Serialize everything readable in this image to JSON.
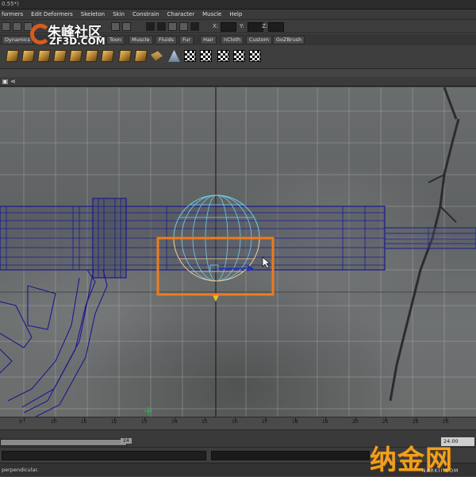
{
  "window": {
    "title_fragment": "0.55*)"
  },
  "menubar": {
    "items": [
      "formers",
      "Edit Deformers",
      "Skeleton",
      "Skin",
      "Constrain",
      "Character",
      "Muscle",
      "Help"
    ]
  },
  "statusline": {
    "x_label": "X:",
    "y_label": "Y:",
    "z_label": "Z:"
  },
  "shelf_tabs": [
    "Dynamics",
    "Toon",
    "Muscle",
    "Fluids",
    "Fur",
    "Hair",
    "nCloth",
    "Custom",
    "GoZBrush"
  ],
  "shelf_icons": [
    "cube-icon",
    "cube-icon",
    "cube-icon",
    "cube-icon",
    "cube-icon",
    "cube-icon",
    "cube-icon",
    "cube-icon",
    "cube-icon",
    "cube-icon",
    "cube-icon",
    "plane-icon",
    "cone-icon",
    "plane-icon",
    "checker-icon",
    "checker-icon",
    "checker-icon",
    "checker-icon",
    "checker-icon"
  ],
  "timeline": {
    "ticks": [
      "9",
      "10",
      "11",
      "12",
      "13",
      "14",
      "15",
      "16",
      "17",
      "18",
      "19",
      "20",
      "21",
      "22",
      "23"
    ],
    "range_end": "24",
    "current_time": "24.00"
  },
  "helpline": {
    "text": "perpendicular."
  },
  "watermarks": {
    "top_cn": "朱峰社区",
    "top_en": "ZF3D.COM",
    "bottom_cn": "纳金网",
    "bottom_en": "NARKII.COM"
  },
  "colors": {
    "selection_highlight": "#f07a1e",
    "wire_blue": "#1a1a8c",
    "sphere_wire": "#6fd0f0",
    "sphere_lower": "#f0c080"
  }
}
